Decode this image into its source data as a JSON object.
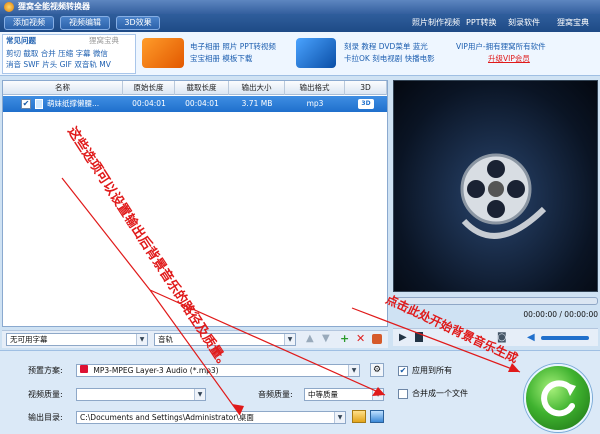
{
  "titlebar": {
    "title": "狸窝全能视频转换器"
  },
  "menubar": {
    "buttons": [
      "添加视频",
      "视频编辑",
      "3D效果"
    ],
    "links": [
      "照片制作视频",
      "PPT转换",
      "刻录软件",
      "狸窝宝典"
    ]
  },
  "ad": {
    "left_title": "常见问题",
    "left_badge": "狸窝宝典",
    "left_line1": "剪切 截取 合并 压缩 字幕 微信",
    "left_line2": "消音 SWF 片头 GIF 双音轨 MV",
    "mid1_line1": "电子相册 照片 PPT转视频",
    "mid1_line2": "宝宝相册 模板下载",
    "mid2_line1": "刻录 教程 DVD菜单 蓝光",
    "mid2_line2": "卡拉OK 刻电视剧 快播电影",
    "right_line1": "VIP用户-拥有狸窝所有软件",
    "right_line2": "升级VIP会员"
  },
  "grid": {
    "columns": [
      "名称",
      "原始长度",
      "截取长度",
      "输出大小",
      "输出格式",
      "3D"
    ],
    "rows": [
      {
        "checked": "✔",
        "name": "萌妹纸撑懒腰...",
        "orig": "00:04:01",
        "cut": "00:04:01",
        "size": "3.71 MB",
        "format": "mp3",
        "threed": "3D"
      }
    ]
  },
  "player": {
    "time": "00:00:00 / 00:00:00"
  },
  "subbar": {
    "subtitle": "无可用字幕",
    "audio": "音轨"
  },
  "settings": {
    "preset_label": "预置方案:",
    "preset_value": "MP3-MPEG Layer-3 Audio (*.mp3)",
    "video_quality_label": "视频质量:",
    "audio_quality_label": "音频质量:",
    "audio_quality_value": "中等质量",
    "output_label": "输出目录:",
    "output_value": "C:\\Documents and Settings\\Administrator\\桌面",
    "apply_all": "应用到所有",
    "apply_all_checked": "✔",
    "merge": "合并成一个文件"
  },
  "annotations": {
    "left": "这些选项可以设置输出后背景音乐的路径及质量。",
    "right": "点击此处开始背景音乐生成"
  },
  "colors": {
    "accent": "#1f6fcc",
    "annotation": "#e01a1a",
    "start": "#3fb22f"
  }
}
